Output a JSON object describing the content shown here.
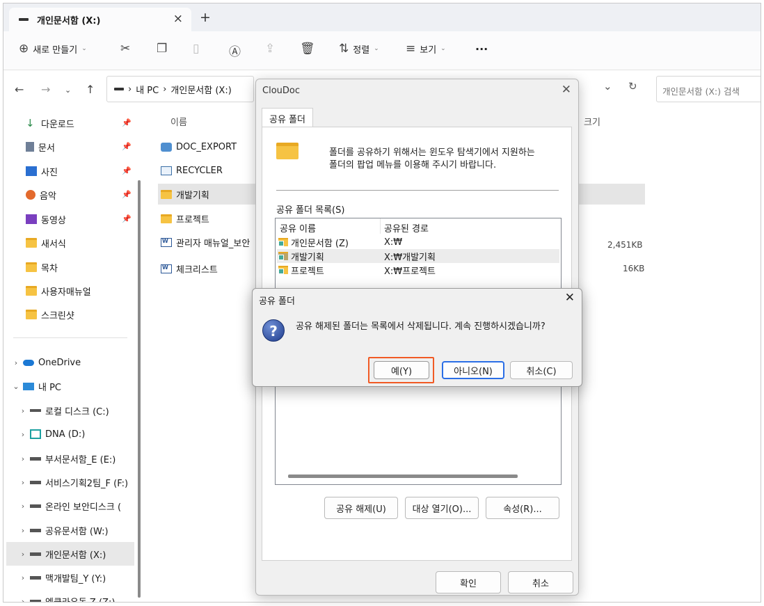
{
  "window": {
    "tab_title": "개인문서함 (X:)",
    "close_tab": "×",
    "new_tab": "+"
  },
  "toolbar": {
    "new_label": "새로 만들기",
    "sort_label": "정렬",
    "view_label": "보기",
    "more_label": "..."
  },
  "address": {
    "crumb_pc": "내 PC",
    "crumb_drive": "개인문서함 (X:)",
    "search_placeholder": "개인문서함 (X:) 검색"
  },
  "nav": {
    "quick": [
      {
        "label": "다운로드",
        "icon": "download-icon"
      },
      {
        "label": "문서",
        "icon": "document-icon"
      },
      {
        "label": "사진",
        "icon": "picture-icon"
      },
      {
        "label": "음악",
        "icon": "music-icon"
      },
      {
        "label": "동영상",
        "icon": "video-icon"
      },
      {
        "label": "새서식",
        "icon": "folder-icon"
      },
      {
        "label": "목차",
        "icon": "folder-icon"
      },
      {
        "label": "사용자매뉴얼",
        "icon": "folder-icon"
      },
      {
        "label": "스크린샷",
        "icon": "folder-icon"
      }
    ],
    "onedrive": "OneDrive",
    "thispc": "내 PC",
    "drives": [
      "로컬 디스크 (C:)",
      "DNA (D:)",
      "부서문서함_E (E:)",
      "서비스기획2팀_F (F:)",
      "온라인 보안디스크 (",
      "공유문서함 (W:)",
      "개인문서함 (X:)",
      "맥개발팀_Y (Y:)",
      "엠클라우독 Z (Z:)"
    ]
  },
  "files": {
    "col_name": "이름",
    "col_size": "크기",
    "rows": [
      {
        "name": "DOC_EXPORT",
        "size": ""
      },
      {
        "name": "RECYCLER",
        "size": ""
      },
      {
        "name": "개발기획",
        "size": ""
      },
      {
        "name": "프로젝트",
        "size": ""
      },
      {
        "name": "관리자 매뉴얼_보안",
        "size": "2,451KB"
      },
      {
        "name": "체크리스트",
        "size": "16KB"
      }
    ]
  },
  "cloudoc": {
    "title": "ClouDoc",
    "tab": "공유 폴더",
    "message_line1": "폴더를 공유하기 위해서는 윈도우 탐색기에서 지원하는",
    "message_line2": "폴더의 팝업 메뉴를 이용해 주시기 바랍니다.",
    "list_label": "공유 폴더 목록(S)",
    "col_share": "공유 이름",
    "col_path": "공유된 경로",
    "shares": [
      {
        "name": "개인문서함 (Z)",
        "path": "X:₩"
      },
      {
        "name": "개발기획",
        "path": "X:₩개발기획"
      },
      {
        "name": "프로젝트",
        "path": "X:₩프로젝트"
      }
    ],
    "btn_unshare": "공유 해제(U)",
    "btn_open": "대상 열기(O)...",
    "btn_props": "속성(R)...",
    "btn_ok": "확인",
    "btn_cancel": "취소"
  },
  "confirm": {
    "title": "공유 폴더",
    "message": "공유 해제된 폴더는 목록에서 삭제됩니다. 계속 진행하시겠습니까?",
    "yes": "예(Y)",
    "no": "아니오(N)",
    "cancel": "취소(C)"
  },
  "colors": {
    "highlight": "#f15a24",
    "accent": "#2a6ee6",
    "folder": "#f6c343"
  }
}
